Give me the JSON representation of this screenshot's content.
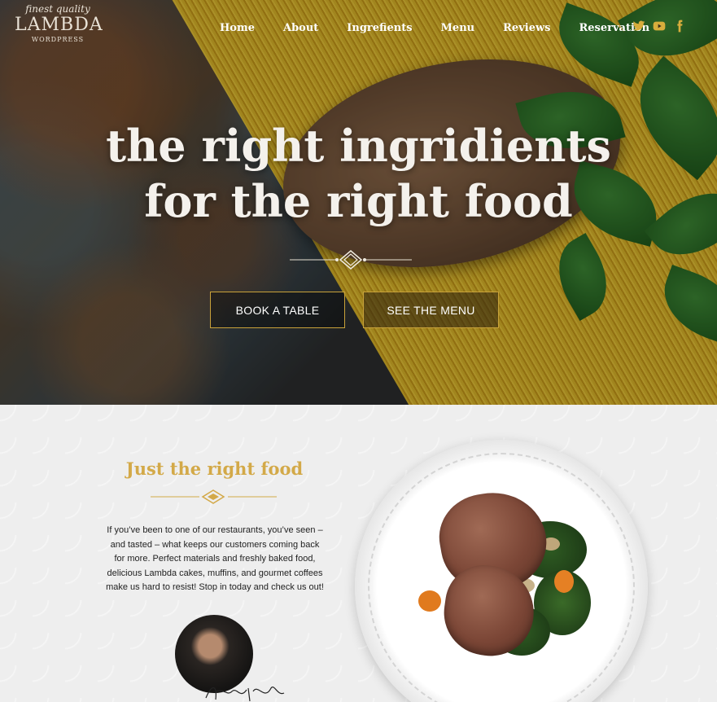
{
  "brand": {
    "logo_top": "finest quality",
    "logo_main": "LAMBDA",
    "logo_bottom": "WORDPRESS"
  },
  "nav": {
    "items": [
      "Home",
      "About",
      "Ingrefients",
      "Menu",
      "Reviews",
      "Reservation"
    ]
  },
  "social": [
    "twitter-icon",
    "youtube-icon",
    "facebook-icon"
  ],
  "hero": {
    "title_line1": "the right ingridients",
    "title_line2": "for the right food",
    "book_button": "BOOK A TABLE",
    "menu_button": "SEE THE MENU"
  },
  "about": {
    "title": "Just the right food",
    "text": "If you’ve been to one of our restaurants, you’ve seen – and tasted – what keeps our customers coming back for more. Perfect materials and freshly baked food, delicious Lambda cakes, muffins, and gourmet coffees make us hard to resist! Stop in today and check us out!"
  },
  "colors": {
    "accent_gold": "#d3a948",
    "button_border": "#c9a23a",
    "social_gold": "#d8ad3c"
  }
}
